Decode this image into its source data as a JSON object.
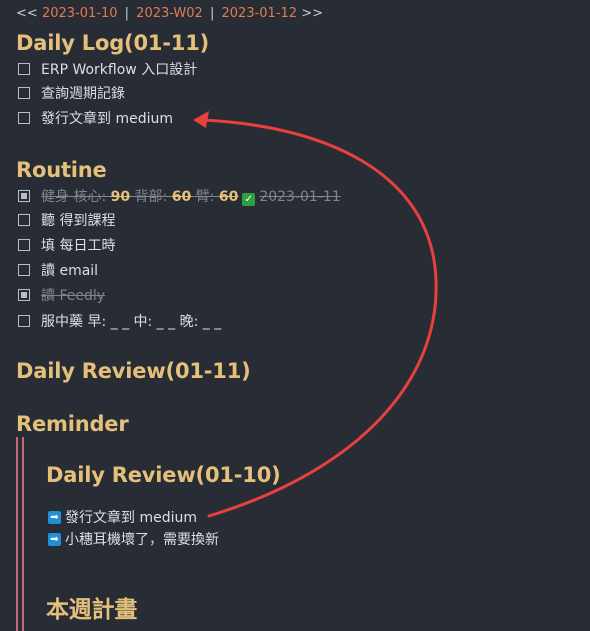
{
  "nav": {
    "prev_prefix": "<<",
    "prev_date": "2023-01-10",
    "sep": "|",
    "week": "2023-W02",
    "next_date": "2023-01-12",
    "next_suffix": ">>"
  },
  "daily_log": {
    "heading": "Daily Log(01-11)",
    "tasks": [
      {
        "label": "ERP Workflow 入口設計",
        "checked": false
      },
      {
        "label": "查詢週期記錄",
        "checked": false
      },
      {
        "label": "發行文章到 medium",
        "checked": false
      }
    ]
  },
  "routine": {
    "heading": "Routine",
    "workout": {
      "pre": "健身 核心: ",
      "core": "90",
      "back_label": " 背部: ",
      "back": "60",
      "arm_label": " 臂: ",
      "arm": "60",
      "check_glyph": "✓",
      "date": "2023-01-11",
      "checked": true
    },
    "tasks": [
      {
        "label": "聽 得到課程",
        "checked": false
      },
      {
        "label": "填 每日工時",
        "checked": false
      },
      {
        "label": "讀 email",
        "checked": false
      },
      {
        "label": "讀 Feedly",
        "checked": true
      },
      {
        "label": "服中藥 早: _ _ 中: _ _ 晚: _ _",
        "checked": false
      }
    ]
  },
  "daily_review": {
    "heading": "Daily Review(01-11)"
  },
  "reminder": {
    "heading": "Reminder",
    "sub_heading": "Daily Review(01-10)",
    "arrow_glyph": "➡",
    "items": [
      "發行文章到 medium",
      "小穗耳機壞了，需要換新"
    ],
    "weekly_heading": "本週計畫"
  },
  "colors": {
    "background": "#282c34",
    "heading": "#e5c07b",
    "link": "#e07b53",
    "annotation_arrow": "#e8403c",
    "reminder_bar": "#c06b75",
    "check_green": "#2ea043",
    "arrow_blue": "#1e90d6"
  }
}
